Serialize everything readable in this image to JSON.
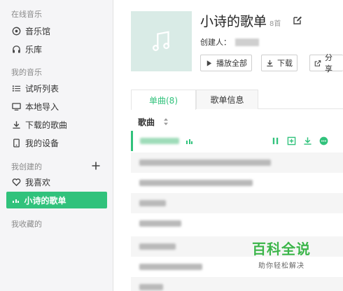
{
  "sidebar": {
    "section_online": "在线音乐",
    "online_items": [
      {
        "label": "音乐馆",
        "icon": "disc-icon"
      },
      {
        "label": "乐库",
        "icon": "headphones-icon"
      }
    ],
    "section_my": "我的音乐",
    "my_items": [
      {
        "label": "试听列表",
        "icon": "list-icon"
      },
      {
        "label": "本地导入",
        "icon": "monitor-icon"
      },
      {
        "label": "下载的歌曲",
        "icon": "download-icon"
      },
      {
        "label": "我的设备",
        "icon": "device-icon"
      }
    ],
    "section_created": "我创建的",
    "created_items": [
      {
        "label": "我喜欢",
        "icon": "heart-icon"
      },
      {
        "label": "小诗的歌单",
        "icon": "playing-bars-icon",
        "active": true
      }
    ],
    "section_collected": "我收藏的"
  },
  "playlist": {
    "title": "小诗的歌单",
    "count": "8首",
    "creator_label": "创建人：",
    "buttons": {
      "play_all": "播放全部",
      "download": "下载",
      "share": "分享"
    }
  },
  "tabs": {
    "songs": "单曲(8)",
    "info": "歌单信息"
  },
  "table": {
    "column_song": "歌曲"
  },
  "watermark": {
    "main": "百科全说",
    "sub": "助你轻松解决"
  },
  "colors": {
    "accent": "#31c27c",
    "sidebar_bg": "#f5f5f7",
    "cover_bg": "#d9ebe6"
  }
}
